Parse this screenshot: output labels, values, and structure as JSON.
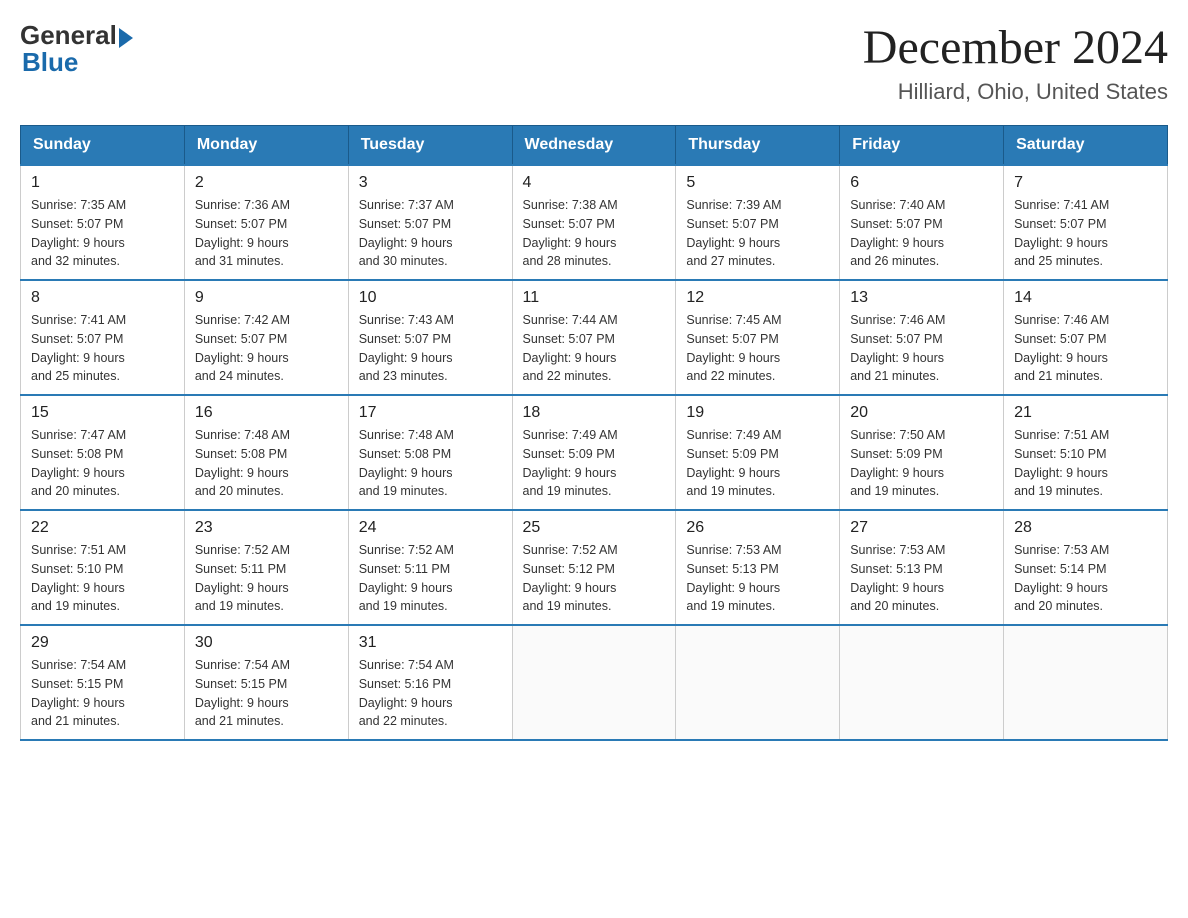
{
  "header": {
    "logo_general": "General",
    "logo_blue": "Blue",
    "month_title": "December 2024",
    "location": "Hilliard, Ohio, United States"
  },
  "days_of_week": [
    "Sunday",
    "Monday",
    "Tuesday",
    "Wednesday",
    "Thursday",
    "Friday",
    "Saturday"
  ],
  "weeks": [
    [
      {
        "day": "1",
        "sunrise": "7:35 AM",
        "sunset": "5:07 PM",
        "daylight": "9 hours and 32 minutes."
      },
      {
        "day": "2",
        "sunrise": "7:36 AM",
        "sunset": "5:07 PM",
        "daylight": "9 hours and 31 minutes."
      },
      {
        "day": "3",
        "sunrise": "7:37 AM",
        "sunset": "5:07 PM",
        "daylight": "9 hours and 30 minutes."
      },
      {
        "day": "4",
        "sunrise": "7:38 AM",
        "sunset": "5:07 PM",
        "daylight": "9 hours and 28 minutes."
      },
      {
        "day": "5",
        "sunrise": "7:39 AM",
        "sunset": "5:07 PM",
        "daylight": "9 hours and 27 minutes."
      },
      {
        "day": "6",
        "sunrise": "7:40 AM",
        "sunset": "5:07 PM",
        "daylight": "9 hours and 26 minutes."
      },
      {
        "day": "7",
        "sunrise": "7:41 AM",
        "sunset": "5:07 PM",
        "daylight": "9 hours and 25 minutes."
      }
    ],
    [
      {
        "day": "8",
        "sunrise": "7:41 AM",
        "sunset": "5:07 PM",
        "daylight": "9 hours and 25 minutes."
      },
      {
        "day": "9",
        "sunrise": "7:42 AM",
        "sunset": "5:07 PM",
        "daylight": "9 hours and 24 minutes."
      },
      {
        "day": "10",
        "sunrise": "7:43 AM",
        "sunset": "5:07 PM",
        "daylight": "9 hours and 23 minutes."
      },
      {
        "day": "11",
        "sunrise": "7:44 AM",
        "sunset": "5:07 PM",
        "daylight": "9 hours and 22 minutes."
      },
      {
        "day": "12",
        "sunrise": "7:45 AM",
        "sunset": "5:07 PM",
        "daylight": "9 hours and 22 minutes."
      },
      {
        "day": "13",
        "sunrise": "7:46 AM",
        "sunset": "5:07 PM",
        "daylight": "9 hours and 21 minutes."
      },
      {
        "day": "14",
        "sunrise": "7:46 AM",
        "sunset": "5:07 PM",
        "daylight": "9 hours and 21 minutes."
      }
    ],
    [
      {
        "day": "15",
        "sunrise": "7:47 AM",
        "sunset": "5:08 PM",
        "daylight": "9 hours and 20 minutes."
      },
      {
        "day": "16",
        "sunrise": "7:48 AM",
        "sunset": "5:08 PM",
        "daylight": "9 hours and 20 minutes."
      },
      {
        "day": "17",
        "sunrise": "7:48 AM",
        "sunset": "5:08 PM",
        "daylight": "9 hours and 19 minutes."
      },
      {
        "day": "18",
        "sunrise": "7:49 AM",
        "sunset": "5:09 PM",
        "daylight": "9 hours and 19 minutes."
      },
      {
        "day": "19",
        "sunrise": "7:49 AM",
        "sunset": "5:09 PM",
        "daylight": "9 hours and 19 minutes."
      },
      {
        "day": "20",
        "sunrise": "7:50 AM",
        "sunset": "5:09 PM",
        "daylight": "9 hours and 19 minutes."
      },
      {
        "day": "21",
        "sunrise": "7:51 AM",
        "sunset": "5:10 PM",
        "daylight": "9 hours and 19 minutes."
      }
    ],
    [
      {
        "day": "22",
        "sunrise": "7:51 AM",
        "sunset": "5:10 PM",
        "daylight": "9 hours and 19 minutes."
      },
      {
        "day": "23",
        "sunrise": "7:52 AM",
        "sunset": "5:11 PM",
        "daylight": "9 hours and 19 minutes."
      },
      {
        "day": "24",
        "sunrise": "7:52 AM",
        "sunset": "5:11 PM",
        "daylight": "9 hours and 19 minutes."
      },
      {
        "day": "25",
        "sunrise": "7:52 AM",
        "sunset": "5:12 PM",
        "daylight": "9 hours and 19 minutes."
      },
      {
        "day": "26",
        "sunrise": "7:53 AM",
        "sunset": "5:13 PM",
        "daylight": "9 hours and 19 minutes."
      },
      {
        "day": "27",
        "sunrise": "7:53 AM",
        "sunset": "5:13 PM",
        "daylight": "9 hours and 20 minutes."
      },
      {
        "day": "28",
        "sunrise": "7:53 AM",
        "sunset": "5:14 PM",
        "daylight": "9 hours and 20 minutes."
      }
    ],
    [
      {
        "day": "29",
        "sunrise": "7:54 AM",
        "sunset": "5:15 PM",
        "daylight": "9 hours and 21 minutes."
      },
      {
        "day": "30",
        "sunrise": "7:54 AM",
        "sunset": "5:15 PM",
        "daylight": "9 hours and 21 minutes."
      },
      {
        "day": "31",
        "sunrise": "7:54 AM",
        "sunset": "5:16 PM",
        "daylight": "9 hours and 22 minutes."
      },
      null,
      null,
      null,
      null
    ]
  ],
  "labels": {
    "sunrise": "Sunrise:",
    "sunset": "Sunset:",
    "daylight": "Daylight:"
  }
}
